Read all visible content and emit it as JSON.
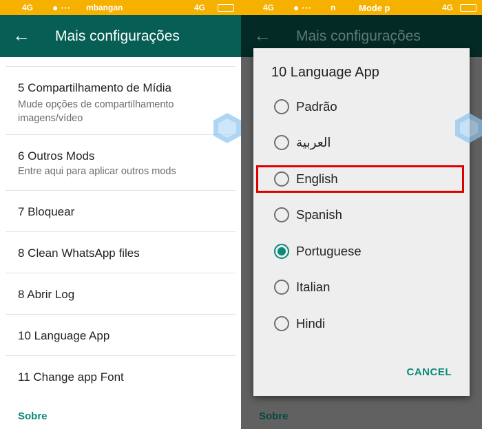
{
  "left": {
    "status": {
      "network": "4G",
      "carrier_text": "mbangan",
      "signal_right": "4G"
    },
    "header": {
      "title": "Mais configurações"
    },
    "items": [
      {
        "title": "5 Compartilhamento de Mídia",
        "subtitle": "Mude opções de compartilhamento imagens/vídeo"
      },
      {
        "title": "6 Outros Mods",
        "subtitle": "Entre aqui para aplicar outros mods"
      },
      {
        "title": "7 Bloquear"
      },
      {
        "title": "8 Clean WhatsApp files"
      },
      {
        "title": "8 Abrir Log"
      },
      {
        "title": "10 Language App"
      },
      {
        "title": "11 Change app Font"
      }
    ],
    "footer": "Sobre"
  },
  "right": {
    "status": {
      "network": "4G",
      "carrier_text": "n",
      "mode_text": "Mode p",
      "signal_right": "4G"
    },
    "header": {
      "title": "Mais configurações"
    },
    "footer": "Sobre",
    "dialog": {
      "title": "10 Language App",
      "options": [
        {
          "label": "Padrão",
          "selected": false
        },
        {
          "label": "العربية",
          "selected": false
        },
        {
          "label": "English",
          "selected": false,
          "highlighted": true
        },
        {
          "label": "Spanish",
          "selected": false
        },
        {
          "label": "Portuguese",
          "selected": true
        },
        {
          "label": "Italian",
          "selected": false
        },
        {
          "label": "Hindi",
          "selected": false
        }
      ],
      "cancel": "CANCEL"
    }
  },
  "colors": {
    "status_bar": "#f5b000",
    "header": "#075e54",
    "accent": "#0a8a78",
    "highlight": "#e00000"
  }
}
